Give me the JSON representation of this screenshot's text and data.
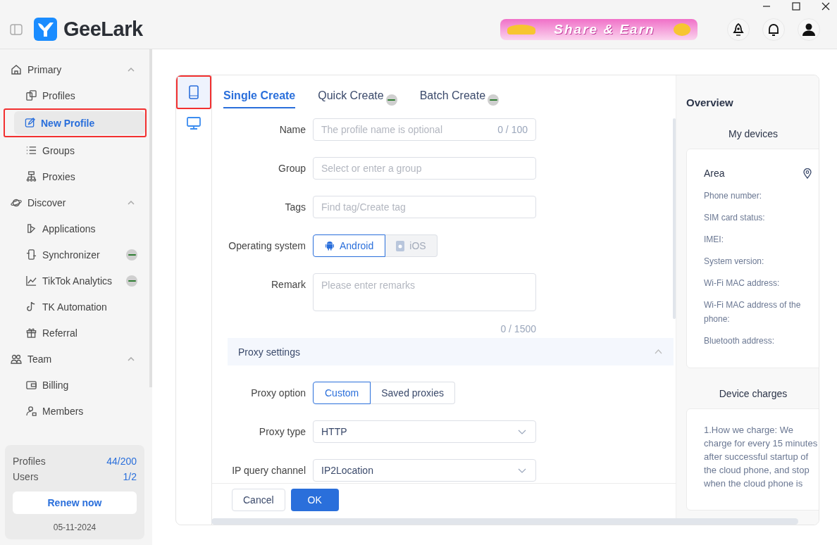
{
  "app": {
    "brand": "GeeLark"
  },
  "promo_banner": {
    "text": "Share & Earn"
  },
  "sidebar": {
    "sections": [
      {
        "label": "Primary",
        "expanded": true,
        "items": [
          {
            "label": "Profiles",
            "selected": false,
            "highlighted": false,
            "badge": false
          },
          {
            "label": "New Profile",
            "selected": true,
            "highlighted": true,
            "badge": false
          },
          {
            "label": "Groups",
            "selected": false,
            "highlighted": false,
            "badge": false
          },
          {
            "label": "Proxies",
            "selected": false,
            "highlighted": false,
            "badge": false
          }
        ]
      },
      {
        "label": "Discover",
        "expanded": true,
        "items": [
          {
            "label": "Applications",
            "selected": false,
            "highlighted": false,
            "badge": false
          },
          {
            "label": "Synchronizer",
            "selected": false,
            "highlighted": false,
            "badge": true
          },
          {
            "label": "TikTok Analytics",
            "selected": false,
            "highlighted": false,
            "badge": true
          },
          {
            "label": "TK Automation",
            "selected": false,
            "highlighted": false,
            "badge": false
          },
          {
            "label": "Referral",
            "selected": false,
            "highlighted": false,
            "badge": false
          }
        ]
      },
      {
        "label": "Team",
        "expanded": true,
        "items": [
          {
            "label": "Billing",
            "selected": false,
            "highlighted": false,
            "badge": false
          },
          {
            "label": "Members",
            "selected": false,
            "highlighted": false,
            "badge": false
          }
        ]
      }
    ]
  },
  "quota": {
    "rows": [
      {
        "label": "Profiles",
        "value": "44/200"
      },
      {
        "label": "Users",
        "value": "1/2"
      }
    ],
    "button": "Renew now",
    "date": "05-11-2024"
  },
  "device_tabs": [
    {
      "kind": "phone",
      "selected": true,
      "highlighted": true
    },
    {
      "kind": "desktop",
      "selected": false,
      "highlighted": false
    }
  ],
  "create_tabs": [
    {
      "label": "Single Create",
      "selected": true,
      "badge": false
    },
    {
      "label": "Quick Create",
      "selected": false,
      "badge": true
    },
    {
      "label": "Batch Create",
      "selected": false,
      "badge": true
    }
  ],
  "form": {
    "fields": [
      {
        "kind": "text",
        "label": "Name",
        "placeholder": "The profile name is optional",
        "counter": "0 / 100"
      },
      {
        "kind": "text",
        "label": "Group",
        "placeholder": "Select or enter a group"
      },
      {
        "kind": "text",
        "label": "Tags",
        "placeholder": "Find tag/Create tag"
      },
      {
        "kind": "os-choice",
        "label": "Operating system",
        "options": [
          {
            "label": "Android",
            "selected": true,
            "disabled": false
          },
          {
            "label": "iOS",
            "selected": false,
            "disabled": true
          }
        ]
      },
      {
        "kind": "textarea",
        "label": "Remark",
        "placeholder": "Please enter remarks",
        "counter": "0 / 1500"
      },
      {
        "kind": "section",
        "label": "Proxy settings",
        "expanded": true
      },
      {
        "kind": "segmented",
        "label": "Proxy option",
        "options": [
          {
            "label": "Custom",
            "selected": true,
            "disabled": false
          },
          {
            "label": "Saved proxies",
            "selected": false,
            "disabled": false
          }
        ]
      },
      {
        "kind": "select",
        "label": "Proxy type",
        "value": "HTTP"
      },
      {
        "kind": "select",
        "label": "IP query channel",
        "value": "IP2Location"
      }
    ]
  },
  "buttons": [
    {
      "label": "Cancel",
      "kind": "secondary"
    },
    {
      "label": "OK",
      "kind": "primary"
    }
  ],
  "overview": {
    "title": "Overview",
    "devices": {
      "title": "My devices",
      "heading": "Area",
      "lines": [
        "Phone number:",
        "SIM card status:",
        "IMEI:",
        "System version:",
        "Wi-Fi MAC address:",
        "Wi-Fi MAC address of the phone:",
        "Bluetooth address:"
      ]
    },
    "charges": {
      "title": "Device charges",
      "text": "1.How we charge: We charge for every 15 minutes after successful startup of the cloud phone, and stop when the cloud phone is"
    }
  }
}
